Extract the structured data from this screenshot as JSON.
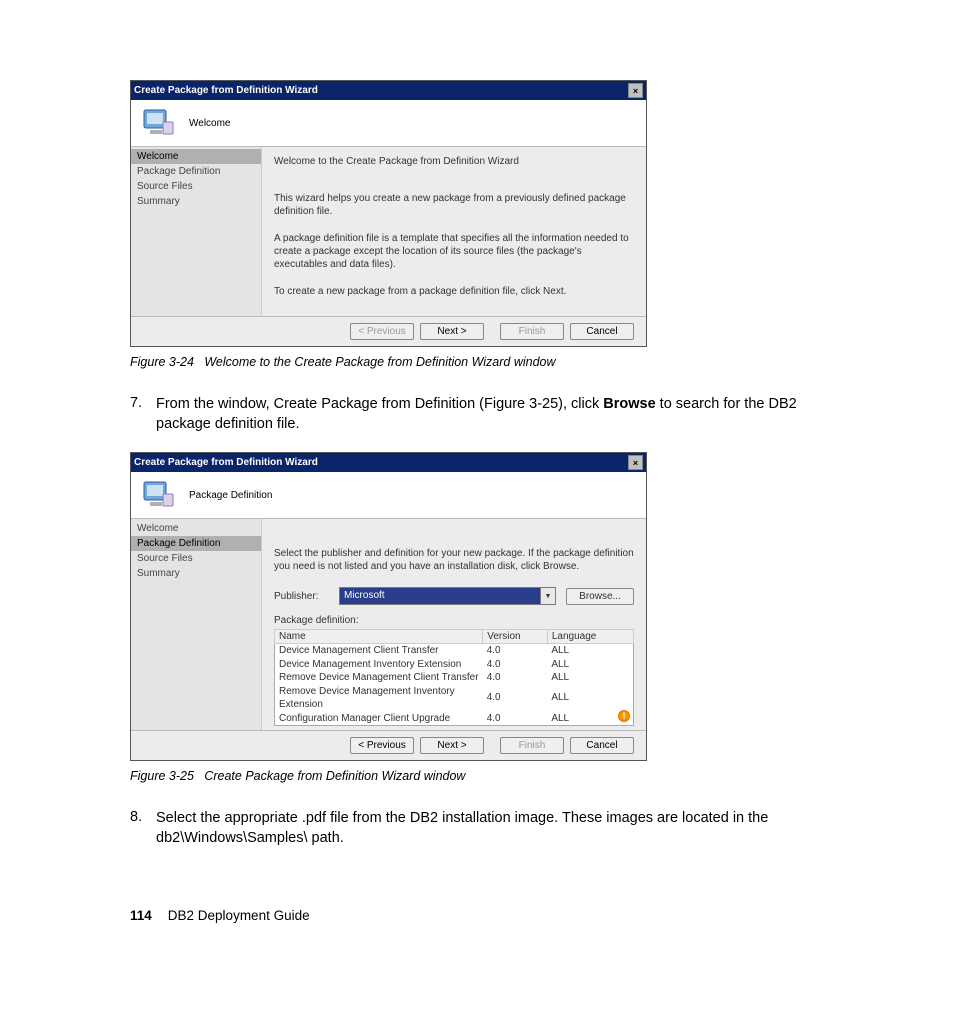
{
  "figure1": {
    "title": "Create Package from Definition Wizard",
    "headerLabel": "Welcome",
    "nav": [
      "Welcome",
      "Package Definition",
      "Source Files",
      "Summary"
    ],
    "activeIndex": 0,
    "p1": "Welcome to the Create Package from Definition Wizard",
    "p2": "This wizard helps you create a new package from a previously defined package definition file.",
    "p3": "A package definition file is a template that specifies all the information needed to create a package except the location of its source files (the package's executables and data files).",
    "p4": "To create a new package from a package definition file, click Next.",
    "buttons": {
      "prev": "< Previous",
      "next": "Next >",
      "finish": "Finish",
      "cancel": "Cancel"
    }
  },
  "caption1": "Figure 3-24   Welcome to the Create Package from Definition Wizard window",
  "step7": {
    "num": "7.",
    "textA": "From the window, Create Package from Definition (Figure 3-25), click ",
    "bold": "Browse",
    "textB": " to search for the DB2 package definition file."
  },
  "figure2": {
    "title": "Create Package from Definition Wizard",
    "headerLabel": "Package Definition",
    "nav": [
      "Welcome",
      "Package Definition",
      "Source Files",
      "Summary"
    ],
    "activeIndex": 1,
    "instr": "Select the publisher and definition for your new package. If the package definition you need is not listed and you have an installation disk, click Browse.",
    "publisherLabel": "Publisher:",
    "publisherValue": "Microsoft",
    "browse": "Browse...",
    "pkgDefLabel": "Package definition:",
    "columns": [
      "Name",
      "Version",
      "Language"
    ],
    "rows": [
      {
        "name": "Device Management Client Transfer",
        "version": "4.0",
        "lang": "ALL"
      },
      {
        "name": "Device Management Inventory Extension",
        "version": "4.0",
        "lang": "ALL"
      },
      {
        "name": "Remove Device Management Client Transfer",
        "version": "4.0",
        "lang": "ALL"
      },
      {
        "name": "Remove Device Management Inventory Extension",
        "version": "4.0",
        "lang": "ALL"
      },
      {
        "name": "Configuration Manager Client Upgrade",
        "version": "4.0",
        "lang": "ALL"
      }
    ],
    "buttons": {
      "prev": "< Previous",
      "next": "Next >",
      "finish": "Finish",
      "cancel": "Cancel"
    }
  },
  "caption2": "Figure 3-25   Create Package from Definition Wizard window",
  "step8": {
    "num": "8.",
    "text": "Select the appropriate .pdf file from the DB2 installation image. These images are located in the db2\\Windows\\Samples\\ path."
  },
  "footer": {
    "page": "114",
    "title": "DB2 Deployment Guide"
  }
}
